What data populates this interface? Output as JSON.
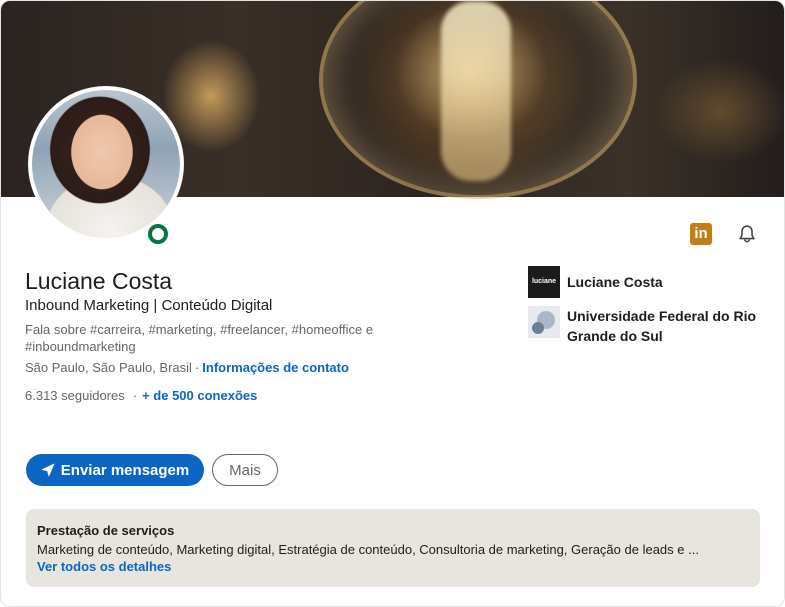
{
  "profile": {
    "name": "Luciane Costa",
    "headline": "Inbound Marketing | Conteúdo Digital",
    "topics": "Fala sobre #carreira, #marketing, #freelancer, #homeoffice e #inboundmarketing",
    "location": "São Paulo, São Paulo, Brasil",
    "location_separator": "·",
    "contact_link": "Informações de contato",
    "followers": "6.313 seguidores",
    "stats_separator": "·",
    "connections": "+ de 500 conexões"
  },
  "header_icons": {
    "linkedin_icon": "linkedin-icon",
    "linkedin_icon_text": "in",
    "bell_icon": "bell-icon"
  },
  "organizations": [
    {
      "name": "Luciane Costa",
      "logo_text": "luciane"
    },
    {
      "name": "Universidade Federal do Rio Grande do Sul"
    }
  ],
  "actions": {
    "primary_label": "Enviar mensagem",
    "secondary_label": "Mais"
  },
  "services": {
    "title": "Prestação de serviços",
    "list": "Marketing de conteúdo, Marketing digital, Estratégia de conteúdo, Consultoria de marketing, Geração de leads e ...",
    "link": "Ver todos os detalhes"
  },
  "colors": {
    "accent": "#0a66c2",
    "online": "#057642",
    "linkedin_badge": "#c37d16",
    "services_bg": "#e8e5df"
  }
}
